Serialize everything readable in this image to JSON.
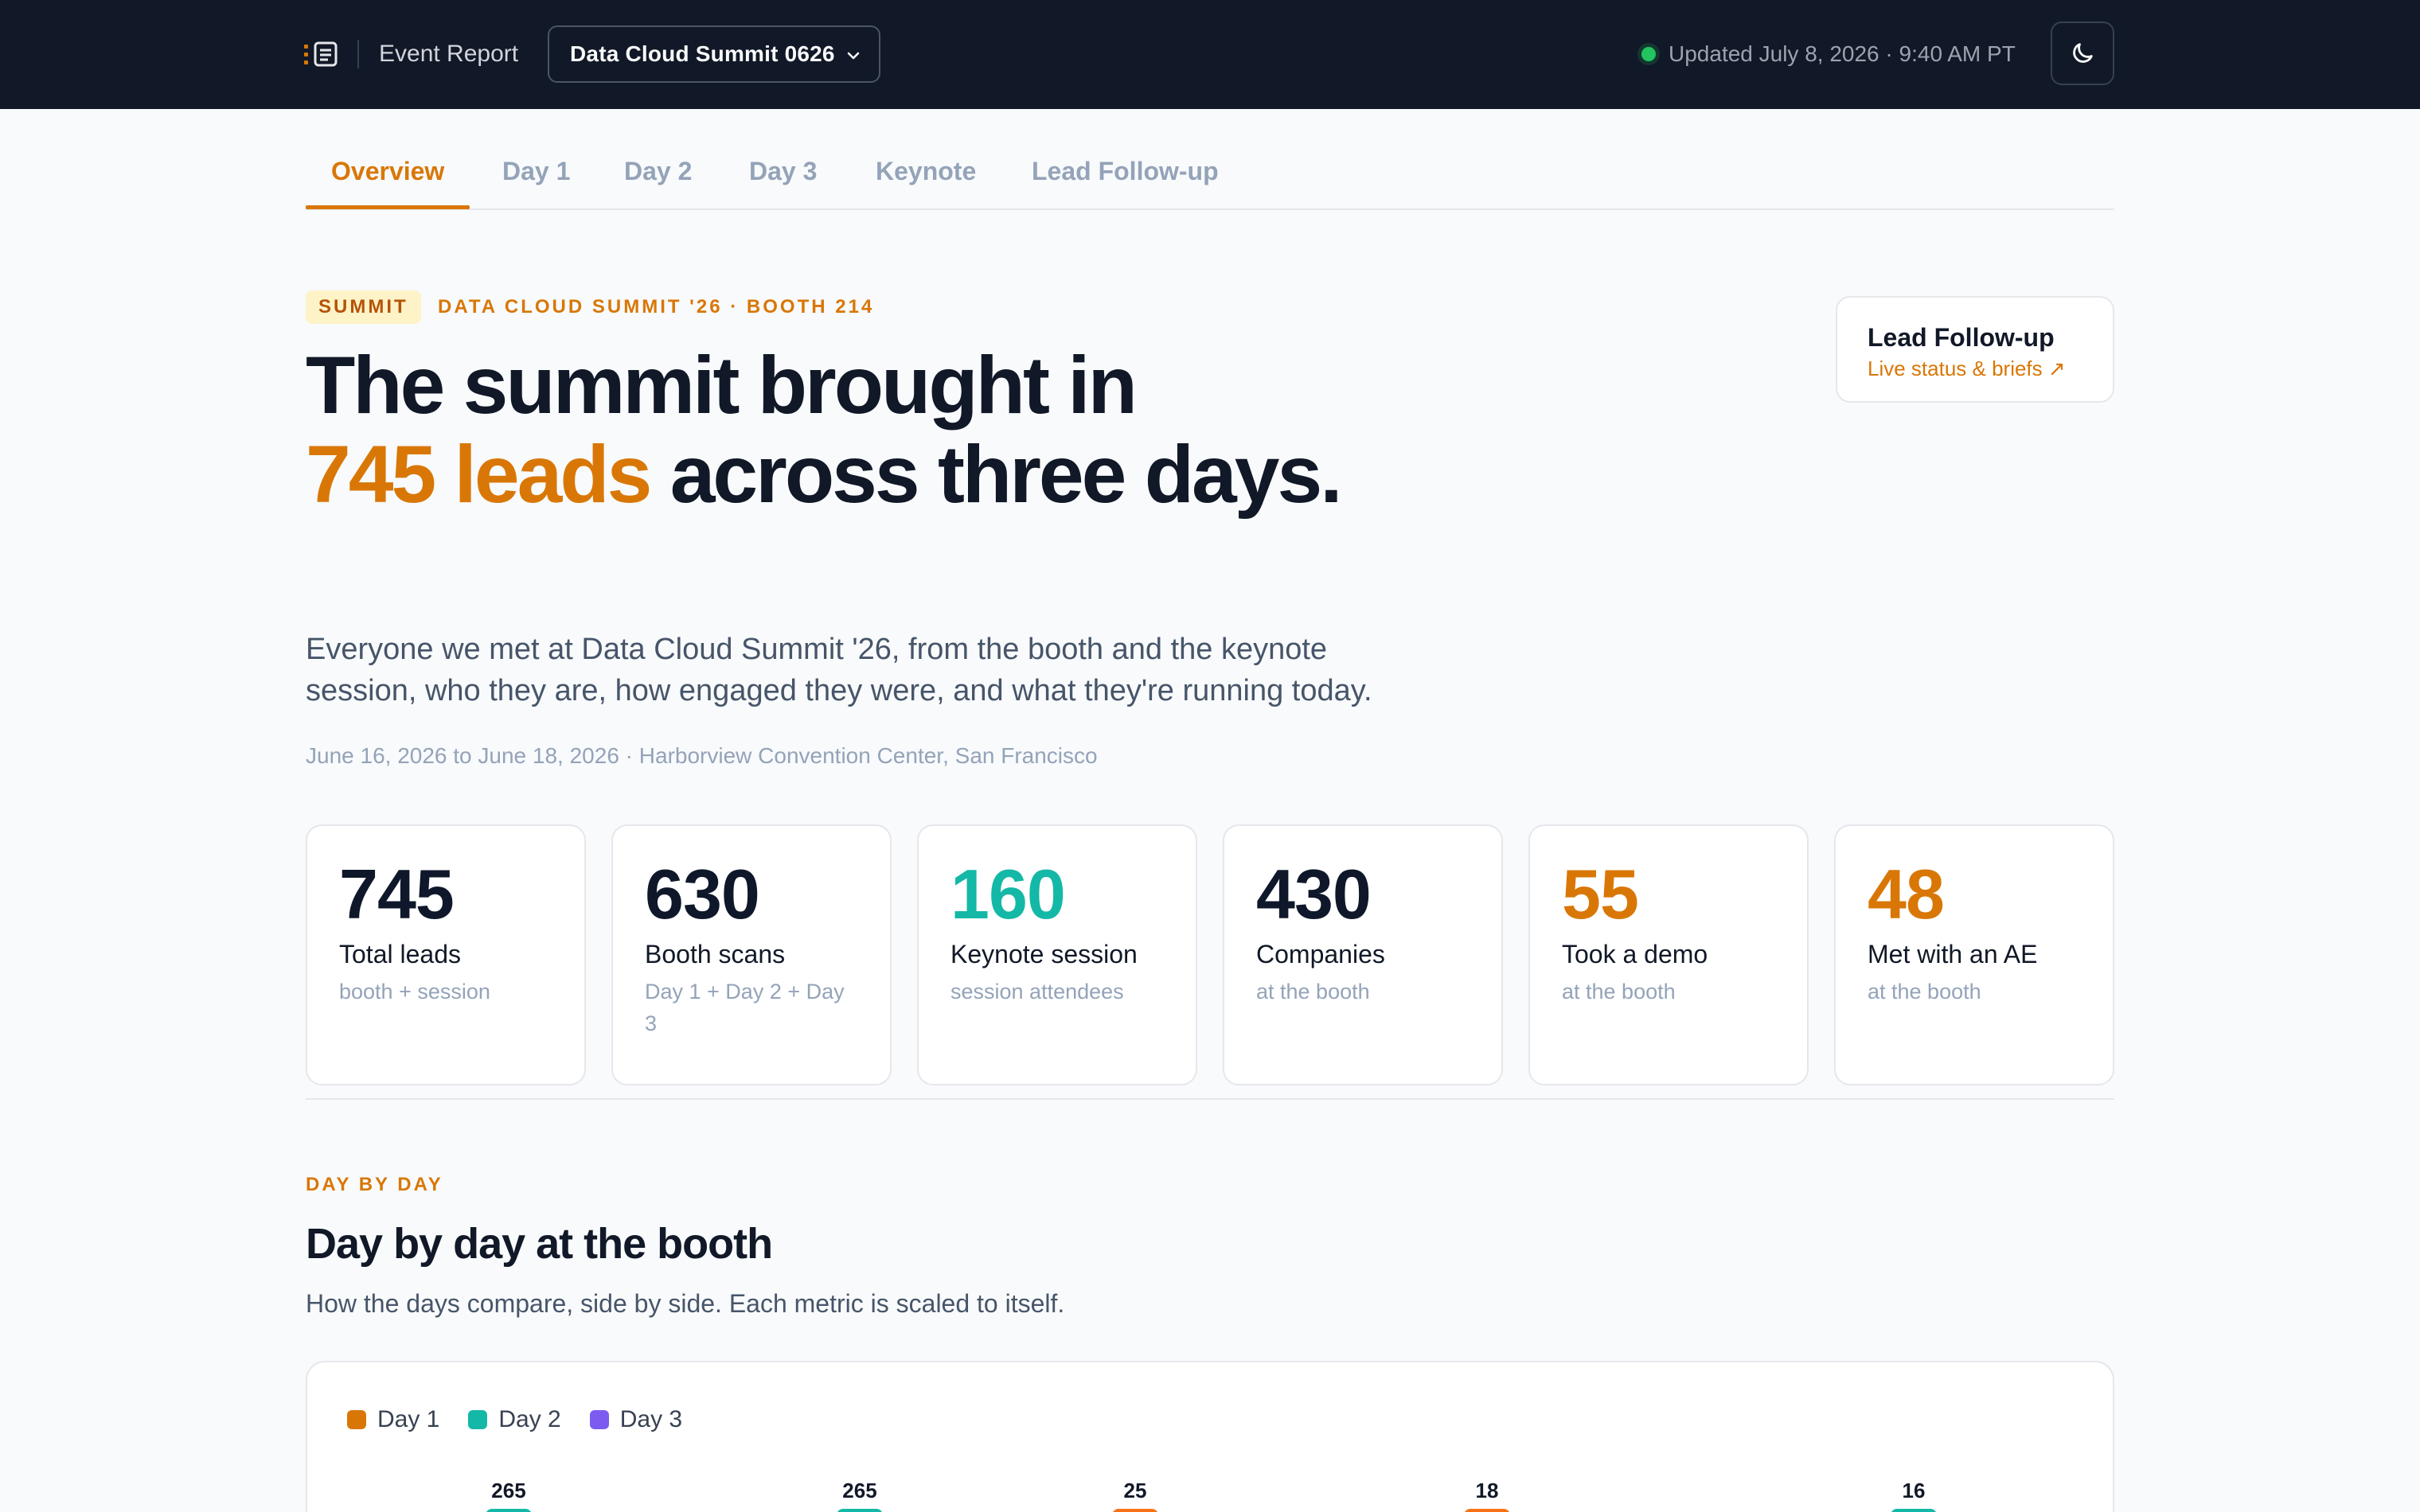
{
  "header": {
    "brand_label": "Event Report",
    "event_select": "Data Cloud Summit 0626",
    "status_text": "Updated July 8, 2026 · 9:40 AM PT",
    "status_color": "#22c55e"
  },
  "tabs": [
    {
      "label": "Overview",
      "active": true
    },
    {
      "label": "Day 1"
    },
    {
      "label": "Day 2"
    },
    {
      "label": "Day 3"
    },
    {
      "label": "Keynote"
    },
    {
      "label": "Lead Follow-up"
    }
  ],
  "hero": {
    "badge": "SUMMIT",
    "kicker": "DATA CLOUD SUMMIT '26 · BOOTH 214",
    "headline_pre": "The summit brought in",
    "headline_accent": "745 leads",
    "headline_post": "across three days.",
    "lede": "Everyone we met at Data Cloud Summit '26, from the booth and the keynote session, who they are, how engaged they were, and what they're running today.",
    "meta": "June 16, 2026 to June 18, 2026 · Harborview Convention Center, San Francisco"
  },
  "followup_card": {
    "title": "Lead Follow-up",
    "subtitle": "Live status & briefs ↗"
  },
  "stats": [
    {
      "value": "745",
      "label": "Total leads",
      "sub": "booth + session",
      "color": "#0f172a"
    },
    {
      "value": "630",
      "label": "Booth scans",
      "sub": "Day 1 + Day 2 + Day 3",
      "color": "#0f172a"
    },
    {
      "value": "160",
      "label": "Keynote session",
      "sub": "session attendees",
      "color": "#14b8a6"
    },
    {
      "value": "430",
      "label": "Companies",
      "sub": "at the booth",
      "color": "#0f172a"
    },
    {
      "value": "55",
      "label": "Took a demo",
      "sub": "at the booth",
      "color": "#d97706"
    },
    {
      "value": "48",
      "label": "Met with an AE",
      "sub": "at the booth",
      "color": "#d97706"
    }
  ],
  "section": {
    "kicker": "DAY BY DAY",
    "title": "Day by day at the booth",
    "description": "How the days compare, side by side. Each metric is scaled to itself."
  },
  "chart_legend": [
    {
      "label": "Day 1",
      "color": "#d97706"
    },
    {
      "label": "Day 2",
      "color": "#14b8a6"
    },
    {
      "label": "Day 3",
      "color": "#7c5cf0"
    }
  ],
  "chart_bars": [
    {
      "value": "265",
      "color": "#14b8a6"
    },
    {
      "value": "265",
      "color": "#14b8a6"
    },
    {
      "value": "25",
      "color": "#f97316"
    },
    {
      "value": "18",
      "color": "#f97316"
    },
    {
      "value": "16",
      "color": "#14b8a6"
    }
  ]
}
